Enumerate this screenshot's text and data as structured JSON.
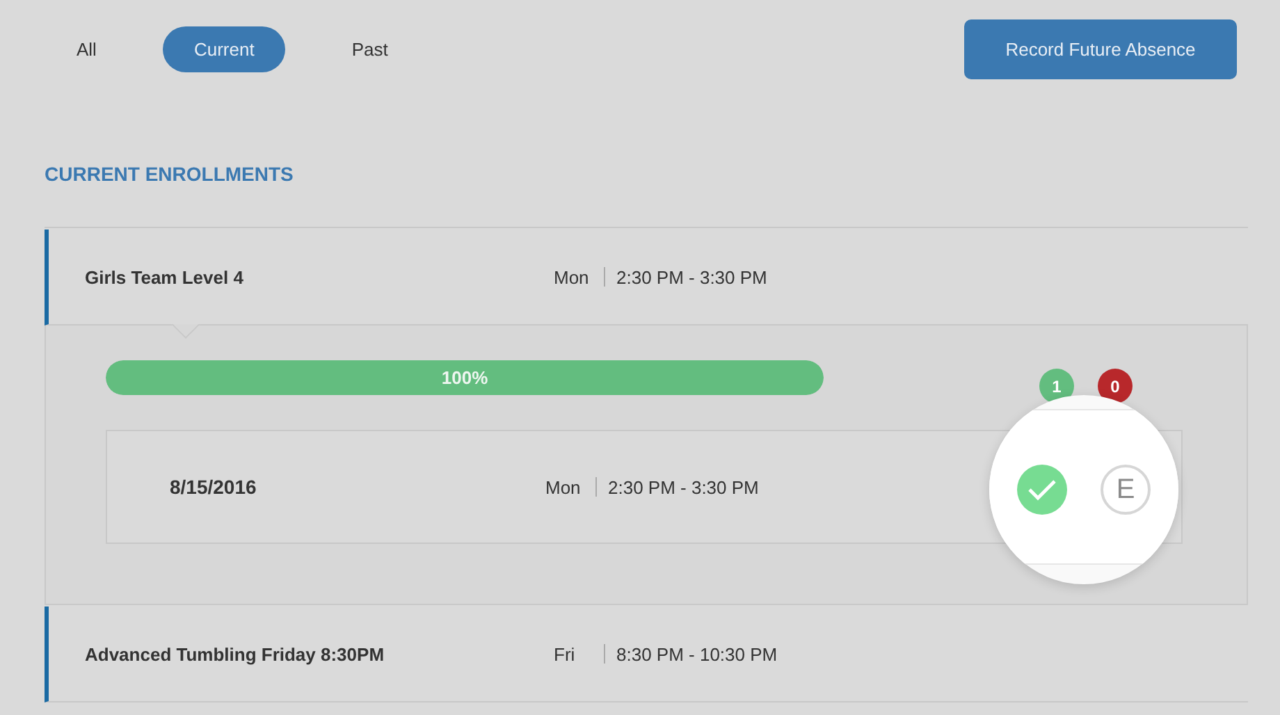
{
  "filter_tabs": [
    {
      "label": "All",
      "selected": false
    },
    {
      "label": "Current",
      "selected": true
    },
    {
      "label": "Past",
      "selected": false
    }
  ],
  "record_button": "Record Future Absence",
  "section_title": "CURRENT ENROLLMENTS",
  "enrollments": [
    {
      "name": "Girls Team Level 4",
      "day": "Mon",
      "time": "2:30 PM - 3:30 PM",
      "expanded": true,
      "progress": {
        "level": 1,
        "label": "100%"
      },
      "counts": [
        {
          "text": "1",
          "color": "#63bd7f"
        },
        {
          "text": "0",
          "color": "#b8282b"
        }
      ],
      "sessions": [
        {
          "date": "8/15/2016",
          "day": "Mon",
          "time": "2:30 PM - 3:30 PM",
          "present": true,
          "excused_label": "E",
          "excused": false
        }
      ]
    },
    {
      "name": "Advanced Tumbling Friday 8:30PM",
      "day": "Fri",
      "time": "8:30 PM - 10:30 PM",
      "expanded": false
    }
  ]
}
